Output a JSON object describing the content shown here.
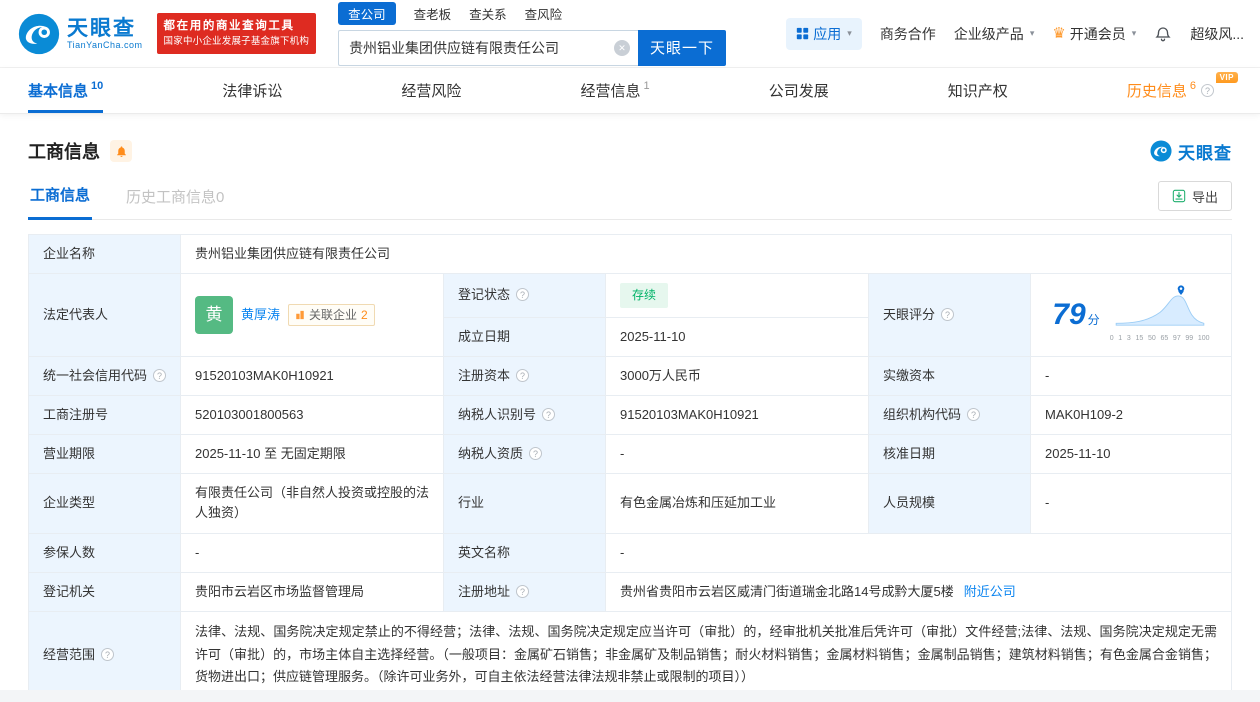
{
  "colors": {
    "primary_blue": "#0b6dd3",
    "link_blue": "#0a84f0",
    "brand_red": "#de2b21",
    "vip_orange": "#ff8c1a",
    "status_green": "#00b368",
    "label_bg": "#ecf5fe"
  },
  "icons": {
    "help": "?",
    "caret": "▾",
    "clear": "✕",
    "crown": "♛"
  },
  "header": {
    "logo": {
      "title": "天眼查",
      "domain": "TianYanCha.com"
    },
    "slogan_line1": "都在用的商业查询工具",
    "slogan_line2": "国家中小企业发展子基金旗下机构",
    "search_tabs": [
      "查公司",
      "查老板",
      "查关系",
      "查风险"
    ],
    "search_value": "贵州铝业集团供应链有限责任公司",
    "search_button": "天眼一下",
    "menu": {
      "apps": "应用",
      "cooperation": "商务合作",
      "products": "企业级产品",
      "vip": "开通会员",
      "user": "超级风..."
    }
  },
  "nav": {
    "tabs": [
      {
        "label": "基本信息",
        "count": "10"
      },
      {
        "label": "法律诉讼"
      },
      {
        "label": "经营风险"
      },
      {
        "label": "经营信息",
        "count": "1"
      },
      {
        "label": "公司发展"
      },
      {
        "label": "知识产权"
      },
      {
        "label": "历史信息",
        "count": "6"
      }
    ],
    "vip_label": "VIP"
  },
  "section": {
    "title": "工商信息",
    "watermark": "天眼查",
    "subtabs": [
      "工商信息",
      "历史工商信息0"
    ],
    "export_label": "导出"
  },
  "table": {
    "company_name": {
      "label": "企业名称",
      "value": "贵州铝业集团供应链有限责任公司"
    },
    "legal_rep": {
      "label": "法定代表人",
      "avatar": "黄",
      "name": "黄厚涛",
      "related_label": "关联企业",
      "related_count": "2"
    },
    "reg_status": {
      "label": "登记状态",
      "value": "存续"
    },
    "establish_date": {
      "label": "成立日期",
      "value": "2025-11-10"
    },
    "score": {
      "label": "天眼评分",
      "value": "79",
      "unit": "分",
      "ticks": [
        "0",
        "1",
        "3",
        "15",
        "50",
        "65",
        "97",
        "99",
        "100"
      ]
    },
    "credit_code": {
      "label": "统一社会信用代码",
      "value": "91520103MAK0H10921"
    },
    "reg_capital": {
      "label": "注册资本",
      "value": "3000万人民币"
    },
    "paid_capital": {
      "label": "实缴资本",
      "value": "-"
    },
    "reg_number": {
      "label": "工商注册号",
      "value": "520103001800563"
    },
    "taxpayer_id": {
      "label": "纳税人识别号",
      "value": "91520103MAK0H10921"
    },
    "org_code": {
      "label": "组织机构代码",
      "value": "MAK0H109-2"
    },
    "business_term": {
      "label": "营业期限",
      "value": "2025-11-10 至 无固定期限"
    },
    "taxpayer_quality": {
      "label": "纳税人资质",
      "value": "-"
    },
    "approval_date": {
      "label": "核准日期",
      "value": "2025-11-10"
    },
    "company_type": {
      "label": "企业类型",
      "value": "有限责任公司（非自然人投资或控股的法人独资）"
    },
    "industry": {
      "label": "行业",
      "value": "有色金属冶炼和压延加工业"
    },
    "staff_size": {
      "label": "人员规模",
      "value": "-"
    },
    "insured_count": {
      "label": "参保人数",
      "value": "-"
    },
    "english_name": {
      "label": "英文名称",
      "value": "-"
    },
    "reg_authority": {
      "label": "登记机关",
      "value": "贵阳市云岩区市场监督管理局"
    },
    "reg_address": {
      "label": "注册地址",
      "value": "贵州省贵阳市云岩区威清门街道瑞金北路14号成黔大厦5楼",
      "link": "附近公司"
    },
    "business_scope": {
      "label": "经营范围",
      "value": "法律、法规、国务院决定规定禁止的不得经营；法律、法规、国务院决定规定应当许可（审批）的，经审批机关批准后凭许可（审批）文件经营;法律、法规、国务院决定规定无需许可（审批）的，市场主体自主选择经营。（一般项目：金属矿石销售；非金属矿及制品销售；耐火材料销售；金属材料销售；金属制品销售；建筑材料销售；有色金属合金销售；货物进出口；供应链管理服务。（除许可业务外，可自主依法经营法律法规非禁止或限制的项目））"
    }
  }
}
